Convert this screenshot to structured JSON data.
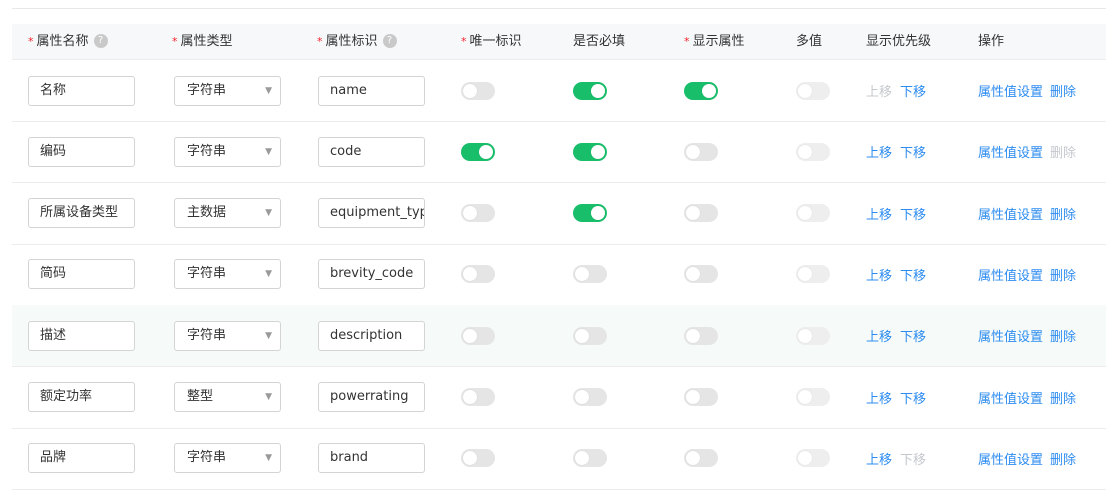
{
  "colors": {
    "accent_link": "#2d8cf0",
    "switch_on": "#19be6b",
    "required_mark": "#f5222d",
    "disabled_text": "#c5c8ce"
  },
  "header": {
    "name": {
      "label": "属性名称",
      "required": "*",
      "help": "?"
    },
    "type": {
      "label": "属性类型",
      "required": "*"
    },
    "key": {
      "label": "属性标识",
      "required": "*",
      "help": "?"
    },
    "unique": {
      "label": "唯一标识",
      "required": "*"
    },
    "must": {
      "label": "是否必填"
    },
    "display": {
      "label": "显示属性",
      "required": "*"
    },
    "multi": {
      "label": "多值"
    },
    "priority": {
      "label": "显示优先级"
    },
    "ops": {
      "label": "操作"
    }
  },
  "rows": [
    {
      "name": "名称",
      "type": "字符串",
      "key": "name",
      "unique": false,
      "must": true,
      "display": true,
      "multi": false,
      "up": "上移",
      "down": "下移",
      "set": "属性值设置",
      "del": "删除"
    },
    {
      "name": "编码",
      "type": "字符串",
      "key": "code",
      "unique": true,
      "must": true,
      "display": false,
      "multi": false,
      "up": "上移",
      "down": "下移",
      "set": "属性值设置",
      "del": "删除"
    },
    {
      "name": "所属设备类型",
      "type": "主数据",
      "key": "equipment_typ",
      "unique": false,
      "must": true,
      "display": false,
      "multi": false,
      "up": "上移",
      "down": "下移",
      "set": "属性值设置",
      "del": "删除"
    },
    {
      "name": "简码",
      "type": "字符串",
      "key": "brevity_code",
      "unique": false,
      "must": false,
      "display": false,
      "multi": false,
      "up": "上移",
      "down": "下移",
      "set": "属性值设置",
      "del": "删除"
    },
    {
      "name": "描述",
      "type": "字符串",
      "key": "description",
      "unique": false,
      "must": false,
      "display": false,
      "multi": false,
      "up": "上移",
      "down": "下移",
      "set": "属性值设置",
      "del": "删除"
    },
    {
      "name": "额定功率",
      "type": "整型",
      "key": "powerrating",
      "unique": false,
      "must": false,
      "display": false,
      "multi": false,
      "up": "上移",
      "down": "下移",
      "set": "属性值设置",
      "del": "删除"
    },
    {
      "name": "品牌",
      "type": "字符串",
      "key": "brand",
      "unique": false,
      "must": false,
      "display": false,
      "multi": false,
      "up": "上移",
      "down": "下移",
      "set": "属性值设置",
      "del": "删除"
    }
  ]
}
